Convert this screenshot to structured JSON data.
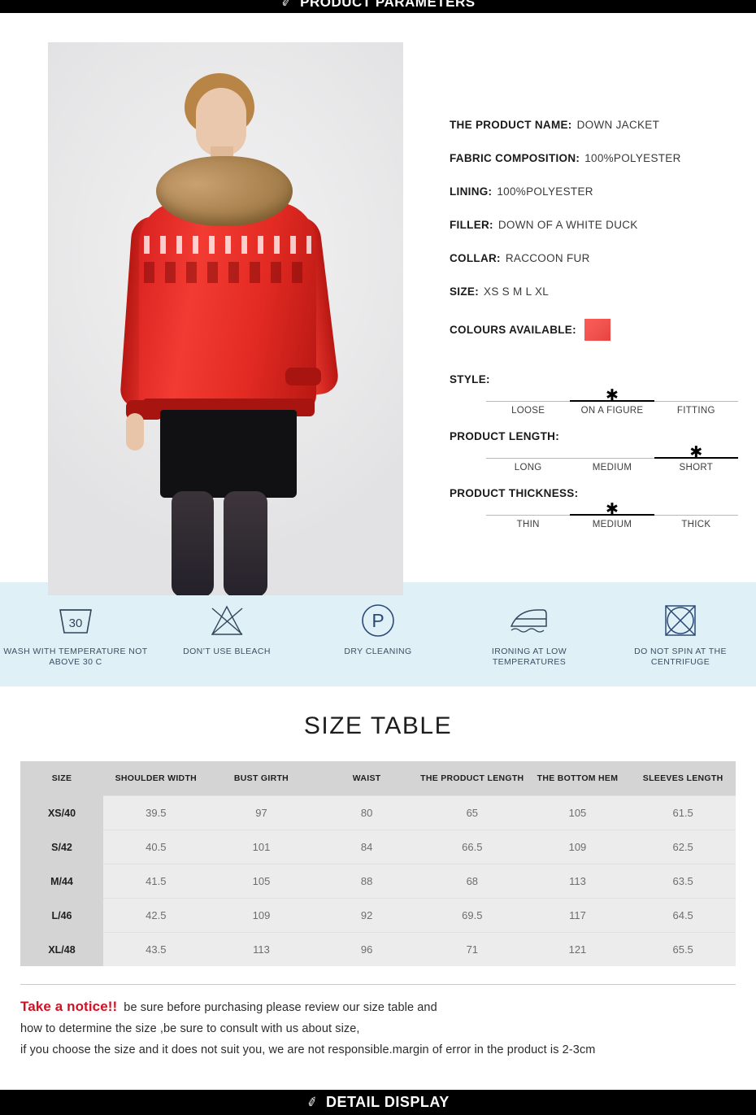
{
  "banners": {
    "top": {
      "logo": "✐",
      "title": "PRODUCT PARAMETERS"
    },
    "bottom": {
      "logo": "✐",
      "title": "DETAIL DISPLAY"
    }
  },
  "specs": [
    {
      "label": "THE PRODUCT NAME:",
      "value": "DOWN JACKET"
    },
    {
      "label": "FABRIC COMPOSITION:",
      "value": "100%POLYESTER"
    },
    {
      "label": "LINING:",
      "value": "100%POLYESTER"
    },
    {
      "label": "FILLER:",
      "value": "DOWN OF A WHITE DUCK"
    },
    {
      "label": "COLLAR:",
      "value": "RACCOON FUR"
    },
    {
      "label": "SIZE:",
      "value": "XS S M L XL"
    },
    {
      "label": "COLOURS AVAILABLE:",
      "value": ""
    }
  ],
  "colour_swatch": "#f0524f",
  "scales": [
    {
      "title": "STYLE:",
      "options": [
        "LOOSE",
        "ON A FIGURE",
        "FITTING"
      ],
      "selected": 1,
      "marker": "✱"
    },
    {
      "title": "PRODUCT LENGTH:",
      "options": [
        "LONG",
        "MEDIUM",
        "SHORT"
      ],
      "selected": 2,
      "marker": "✱"
    },
    {
      "title": "PRODUCT THICKNESS:",
      "options": [
        "THIN",
        "MEDIUM",
        "THICK"
      ],
      "selected": 1,
      "marker": "✱"
    }
  ],
  "care": {
    "background": "#dff0f7",
    "items": [
      {
        "icon": "wash-tub-icon",
        "temp": "30",
        "text": "WASH WITH TEMPERATURE NOT ABOVE 30 C"
      },
      {
        "icon": "no-bleach-icon",
        "temp": "",
        "text": "DON’T USE BLEACH"
      },
      {
        "icon": "dry-clean-icon",
        "temp": "P",
        "text": "DRY CLEANING"
      },
      {
        "icon": "iron-low-icon",
        "temp": "",
        "text": "IRONING AT LOW TEMPERATURES"
      },
      {
        "icon": "no-spin-icon",
        "temp": "",
        "text": "DO NOT SPIN AT THE CENTRIFUGE"
      }
    ]
  },
  "size_table": {
    "title": "SIZE TABLE",
    "headers": [
      "SIZE",
      "SHOULDER WIDTH",
      "BUST GIRTH",
      "WAIST",
      "THE PRODUCT LENGTH",
      "THE BOTTOM HEM",
      "SLEEVES LENGTH"
    ],
    "rows": [
      [
        "XS/40",
        "39.5",
        "97",
        "80",
        "65",
        "105",
        "61.5"
      ],
      [
        "S/42",
        "40.5",
        "101",
        "84",
        "66.5",
        "109",
        "62.5"
      ],
      [
        "M/44",
        "41.5",
        "105",
        "88",
        "68",
        "113",
        "63.5"
      ],
      [
        "L/46",
        "42.5",
        "109",
        "92",
        "69.5",
        "117",
        "64.5"
      ],
      [
        "XL/48",
        "43.5",
        "113",
        "96",
        "71",
        "121",
        "65.5"
      ]
    ]
  },
  "notice": {
    "heading": "Take a notice!!",
    "line1": "be sure before purchasing please review our size table and",
    "line2": "how to determine the size ,be sure to consult with us about size,",
    "line3": "if you choose the size and it does not suit you, we are not responsible.margin of error in the product is 2-3cm"
  }
}
